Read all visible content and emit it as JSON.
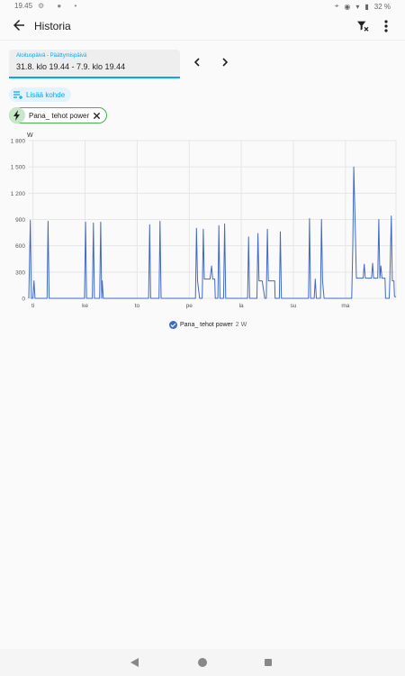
{
  "status": {
    "time": "19.45",
    "battery": "32 %"
  },
  "app_bar": {
    "title": "Historia"
  },
  "date_range": {
    "label": "Aloituspäivä - Päättymispäivä",
    "value": "31.8. klo 19.44 - 7.9. klo 19.44"
  },
  "add_target_label": "Lisää kohde",
  "entity": {
    "name": "Pana_ tehot power"
  },
  "legend": {
    "name": "Pana_ tehot power",
    "value": "2 W"
  },
  "colors": {
    "accent": "#03a9f4",
    "series": "#4169c4",
    "chip_border": "#4caf50"
  },
  "chart_data": {
    "type": "line",
    "ylabel": "W",
    "ylim": [
      0,
      1800
    ],
    "yticks": [
      "0",
      "300",
      "600",
      "900",
      "1 200",
      "1 500",
      "1 800"
    ],
    "xticks": [
      "ti",
      "ke",
      "to",
      "pe",
      "la",
      "su",
      "ma"
    ],
    "xlim": [
      0,
      7.05
    ],
    "series": [
      {
        "name": "Pana_ tehot power",
        "points": [
          [
            0.0,
            0
          ],
          [
            0.03,
            890
          ],
          [
            0.05,
            0
          ],
          [
            0.08,
            0
          ],
          [
            0.1,
            200
          ],
          [
            0.12,
            0
          ],
          [
            0.35,
            0
          ],
          [
            0.37,
            880
          ],
          [
            0.39,
            0
          ],
          [
            1.07,
            0
          ],
          [
            1.09,
            870
          ],
          [
            1.11,
            0
          ],
          [
            1.22,
            0
          ],
          [
            1.24,
            860
          ],
          [
            1.26,
            0
          ],
          [
            1.36,
            0
          ],
          [
            1.38,
            870
          ],
          [
            1.4,
            0
          ],
          [
            1.41,
            200
          ],
          [
            1.43,
            0
          ],
          [
            2.3,
            0
          ],
          [
            2.32,
            840
          ],
          [
            2.34,
            0
          ],
          [
            2.5,
            0
          ],
          [
            2.52,
            880
          ],
          [
            2.54,
            0
          ],
          [
            3.2,
            0
          ],
          [
            3.22,
            800
          ],
          [
            3.24,
            200
          ],
          [
            3.28,
            0
          ],
          [
            3.33,
            0
          ],
          [
            3.35,
            790
          ],
          [
            3.37,
            220
          ],
          [
            3.48,
            220
          ],
          [
            3.51,
            370
          ],
          [
            3.53,
            220
          ],
          [
            3.57,
            220
          ],
          [
            3.58,
            0
          ],
          [
            3.63,
            0
          ],
          [
            3.65,
            830
          ],
          [
            3.67,
            0
          ],
          [
            3.74,
            0
          ],
          [
            3.76,
            850
          ],
          [
            3.78,
            0
          ],
          [
            4.2,
            0
          ],
          [
            4.22,
            700
          ],
          [
            4.24,
            0
          ],
          [
            4.38,
            0
          ],
          [
            4.4,
            740
          ],
          [
            4.42,
            200
          ],
          [
            4.48,
            200
          ],
          [
            4.53,
            0
          ],
          [
            4.56,
            0
          ],
          [
            4.58,
            790
          ],
          [
            4.6,
            200
          ],
          [
            4.72,
            200
          ],
          [
            4.73,
            0
          ],
          [
            4.81,
            0
          ],
          [
            4.83,
            760
          ],
          [
            4.85,
            0
          ],
          [
            5.37,
            0
          ],
          [
            5.39,
            910
          ],
          [
            5.41,
            0
          ],
          [
            5.48,
            0
          ],
          [
            5.5,
            220
          ],
          [
            5.52,
            0
          ],
          [
            5.6,
            0
          ],
          [
            5.62,
            900
          ],
          [
            5.64,
            200
          ],
          [
            5.67,
            0
          ],
          [
            6.2,
            0
          ],
          [
            6.22,
            600
          ],
          [
            6.24,
            1500
          ],
          [
            6.26,
            1000
          ],
          [
            6.29,
            230
          ],
          [
            6.42,
            230
          ],
          [
            6.44,
            390
          ],
          [
            6.46,
            230
          ],
          [
            6.58,
            230
          ],
          [
            6.6,
            400
          ],
          [
            6.62,
            230
          ],
          [
            6.7,
            230
          ],
          [
            6.72,
            900
          ],
          [
            6.74,
            230
          ],
          [
            6.76,
            370
          ],
          [
            6.78,
            230
          ],
          [
            6.84,
            230
          ],
          [
            6.85,
            0
          ],
          [
            6.92,
            0
          ],
          [
            6.93,
            200
          ],
          [
            6.96,
            940
          ],
          [
            6.98,
            200
          ],
          [
            7.01,
            200
          ],
          [
            7.02,
            20
          ],
          [
            7.05,
            20
          ]
        ]
      }
    ]
  }
}
